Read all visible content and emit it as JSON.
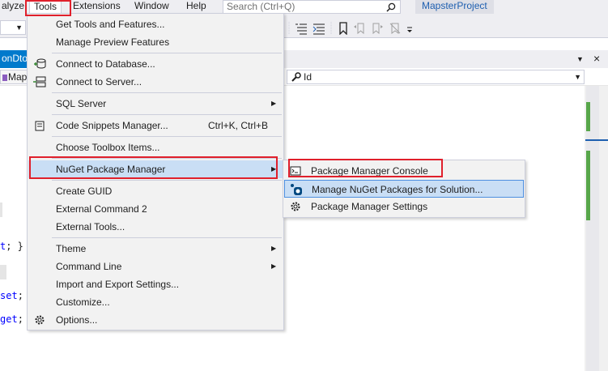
{
  "menubar": {
    "items": [
      {
        "label": "alyze"
      },
      {
        "label": "Tools"
      },
      {
        "label": "Extensions"
      },
      {
        "label": "Window"
      },
      {
        "label": "Help"
      }
    ],
    "search_placeholder": "Search (Ctrl+Q)",
    "project_name": "MapsterProject"
  },
  "tabs": {
    "active_tab_label": "onDto"
  },
  "navbar": {
    "left_label": "Maps",
    "right_label": "Id"
  },
  "editor": {
    "lines": [
      {
        "keyword": "t",
        "punct": "; }"
      },
      {
        "keyword": "set",
        "punct": ";"
      },
      {
        "keyword": "get",
        "punct": ";"
      }
    ]
  },
  "tools_menu": {
    "items": [
      {
        "label": "Get Tools and Features...",
        "icon": "none"
      },
      {
        "label": "Manage Preview Features",
        "icon": "none"
      },
      {
        "label": "Connect to Database...",
        "icon": "database-connect-icon"
      },
      {
        "label": "Connect to Server...",
        "icon": "server-connect-icon"
      },
      {
        "label": "SQL Server",
        "icon": "none",
        "has_submenu": true
      },
      {
        "label": "Code Snippets Manager...",
        "shortcut": "Ctrl+K, Ctrl+B",
        "icon": "snippet-icon"
      },
      {
        "label": "Choose Toolbox Items...",
        "icon": "none"
      },
      {
        "label": "NuGet Package Manager",
        "icon": "none",
        "has_submenu": true,
        "highlighted": true
      },
      {
        "label": "Create GUID",
        "icon": "none"
      },
      {
        "label": "External Command 2",
        "icon": "none"
      },
      {
        "label": "External Tools...",
        "icon": "none"
      },
      {
        "label": "Theme",
        "icon": "none",
        "has_submenu": true
      },
      {
        "label": "Command Line",
        "icon": "none",
        "has_submenu": true
      },
      {
        "label": "Import and Export Settings...",
        "icon": "none"
      },
      {
        "label": "Customize...",
        "icon": "none"
      },
      {
        "label": "Options...",
        "icon": "gear-icon"
      }
    ]
  },
  "nuget_submenu": {
    "items": [
      {
        "label": "Package Manager Console",
        "icon": "console-icon"
      },
      {
        "label": "Manage NuGet Packages for Solution...",
        "icon": "nuget-icon",
        "highlighted": true
      },
      {
        "label": "Package Manager Settings",
        "icon": "gear-icon"
      }
    ]
  },
  "colors": {
    "accent": "#007acc",
    "menu_highlight": "#c9def5",
    "annotation_red": "#e0202c",
    "scroll_marker_green": "#57a64a"
  }
}
